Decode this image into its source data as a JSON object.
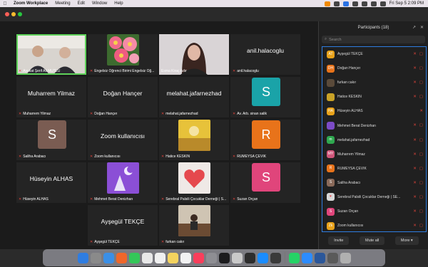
{
  "menubar": {
    "app_name": "Zoom Workplace",
    "items": [
      "Meeting",
      "Edit",
      "Window",
      "Help"
    ],
    "clock": "Fri Sep 5  2:09 PM"
  },
  "gallery": {
    "tiles": [
      {
        "name": "Avukat Şerif Ali MUTLU",
        "display": "",
        "kind": "photo-men",
        "active": true
      },
      {
        "name": "Engelsiz Öğrenci Birimi Engelsiz Öğ...",
        "display": "",
        "kind": "flower"
      },
      {
        "name": "Esma Kiraç Adır",
        "display": "",
        "kind": "photo-woman"
      },
      {
        "name": "anil.halacoglu",
        "display": "anil.halacoglu",
        "kind": "text"
      },
      {
        "name": "Muharrem Yilmaz",
        "display": "Muharrem Yilmaz",
        "kind": "text"
      },
      {
        "name": "Doğan Hançer",
        "display": "Doğan Hançer",
        "kind": "text"
      },
      {
        "name": "melahat.jafarnezhad",
        "display": "melahat.jafarnezhad",
        "kind": "text"
      },
      {
        "name": "Av. Arb. sinan salik",
        "display": "",
        "kind": "avatar",
        "letter": "S",
        "color": "#1aa3a8"
      },
      {
        "name": "Saliha Arabacı",
        "display": "",
        "kind": "avatar",
        "letter": "S",
        "color": "#7a5c52"
      },
      {
        "name": "Zoom kullanıcısı",
        "display": "Zoom kullanıcısı",
        "kind": "text"
      },
      {
        "name": "Hatice KESKİN",
        "display": "",
        "kind": "yellow-art"
      },
      {
        "name": "RUMEYSA ÇEVİK",
        "display": "",
        "kind": "avatar",
        "letter": "R",
        "color": "#e8731a"
      },
      {
        "name": "Hüseyin ALHAS",
        "display": "Hüseyin ALHAS",
        "kind": "text"
      },
      {
        "name": "Mehmet Berat Denizhan",
        "display": "",
        "kind": "purple-art"
      },
      {
        "name": "Serebral Palsili Çocuklar Derneği | S...",
        "display": "",
        "kind": "heart-art"
      },
      {
        "name": "Suzan Orçan",
        "display": "",
        "kind": "avatar",
        "letter": "S",
        "color": "#e0457b"
      },
      {
        "name": "Ayşegül TEKÇE",
        "display": "Ayşegül TEKÇE",
        "kind": "text"
      },
      {
        "name": "furkan cakır",
        "display": "",
        "kind": "room-photo"
      }
    ]
  },
  "participants": {
    "title": "Participants (18)",
    "search_placeholder": "Search",
    "list": [
      {
        "name": "Ayşegül TEKÇE",
        "initials": "AT",
        "color": "#e8a21a"
      },
      {
        "name": "Doğan Hançer",
        "initials": "DH",
        "color": "#e8731a"
      },
      {
        "name": "furkan cakır",
        "initials": "",
        "color": "#5a4a3a"
      },
      {
        "name": "Hatice KESKİN",
        "initials": "",
        "color": "#c9a227"
      },
      {
        "name": "Hüseyin ALHAS",
        "initials": "HA",
        "color": "#e8a21a"
      },
      {
        "name": "Mehmet Berat Denizhan",
        "initials": "",
        "color": "#7c4bc6"
      },
      {
        "name": "melahat.jafarnezhad",
        "initials": "m",
        "color": "#2fa84f"
      },
      {
        "name": "Muharrem Yilmaz",
        "initials": "MY",
        "color": "#d0567a"
      },
      {
        "name": "RUMEYSA ÇEVİK",
        "initials": "R",
        "color": "#e8731a"
      },
      {
        "name": "Saliha Arabacı",
        "initials": "S",
        "color": "#8a6a5a"
      },
      {
        "name": "Serebral Palsili Çocuklar Derneği | SE...",
        "initials": "",
        "color": "#d8d8d8"
      },
      {
        "name": "Suzan Orçan",
        "initials": "S",
        "color": "#e0457b"
      },
      {
        "name": "Zoom kullanıcısı",
        "initials": "Zk",
        "color": "#e8a21a"
      }
    ],
    "footer": {
      "invite": "Invite",
      "mute_all": "Mute all",
      "more": "More"
    }
  },
  "colors": {
    "accent": "#2f7de1",
    "active_speaker": "#5fd35a",
    "mute_red": "#e0443b"
  }
}
